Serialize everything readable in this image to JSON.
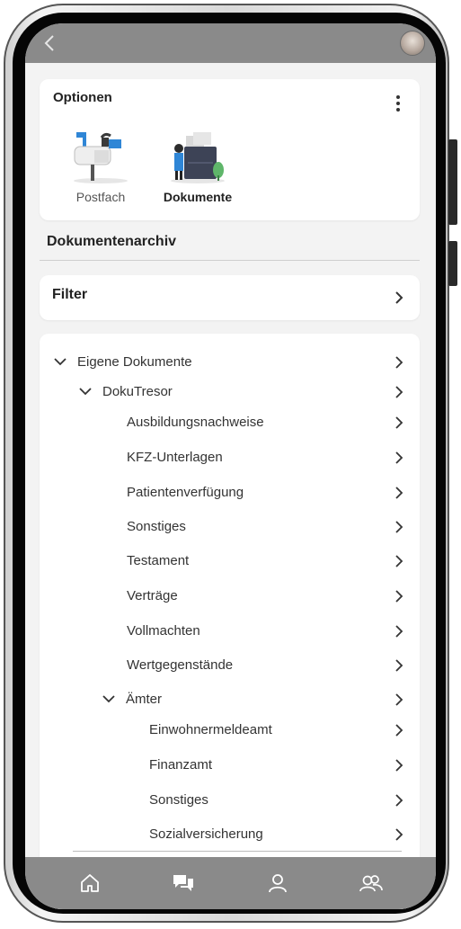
{
  "options": {
    "title": "Optionen",
    "items": [
      {
        "label": "Postfach",
        "icon": "mailbox-icon"
      },
      {
        "label": "Dokumente",
        "icon": "documents-icon",
        "active": true
      }
    ]
  },
  "archive": {
    "title": "Dokumentenarchiv",
    "filter_label": "Filter"
  },
  "tree": {
    "items": [
      {
        "label": "Eigene Dokumente",
        "level": 0,
        "expanded": true
      },
      {
        "label": "DokuTresor",
        "level": 1,
        "expanded": true
      },
      {
        "label": "Ausbildungsnachweise",
        "level": 2
      },
      {
        "label": "KFZ-Unterlagen",
        "level": 2
      },
      {
        "label": "Patientenverfügung",
        "level": 2
      },
      {
        "label": "Sonstiges",
        "level": 2
      },
      {
        "label": "Testament",
        "level": 2
      },
      {
        "label": "Verträge",
        "level": 2
      },
      {
        "label": "Vollmachten",
        "level": 2
      },
      {
        "label": "Wertgegenstände",
        "level": 2
      },
      {
        "label": "Ämter",
        "level": 2,
        "expanded": true
      },
      {
        "label": "Einwohnermeldeamt",
        "level": 3
      },
      {
        "label": "Finanzamt",
        "level": 3
      },
      {
        "label": "Sonstiges",
        "level": 3
      },
      {
        "label": "Sozialversicherung",
        "level": 3
      }
    ]
  },
  "nav": {
    "items": [
      "home-icon",
      "chat-icon",
      "user-icon",
      "users-icon"
    ]
  },
  "colors": {
    "bar": "#8a8a8a",
    "screen_bg": "#f3f3f3",
    "card": "#ffffff",
    "accent_blue": "#2f86d6"
  }
}
